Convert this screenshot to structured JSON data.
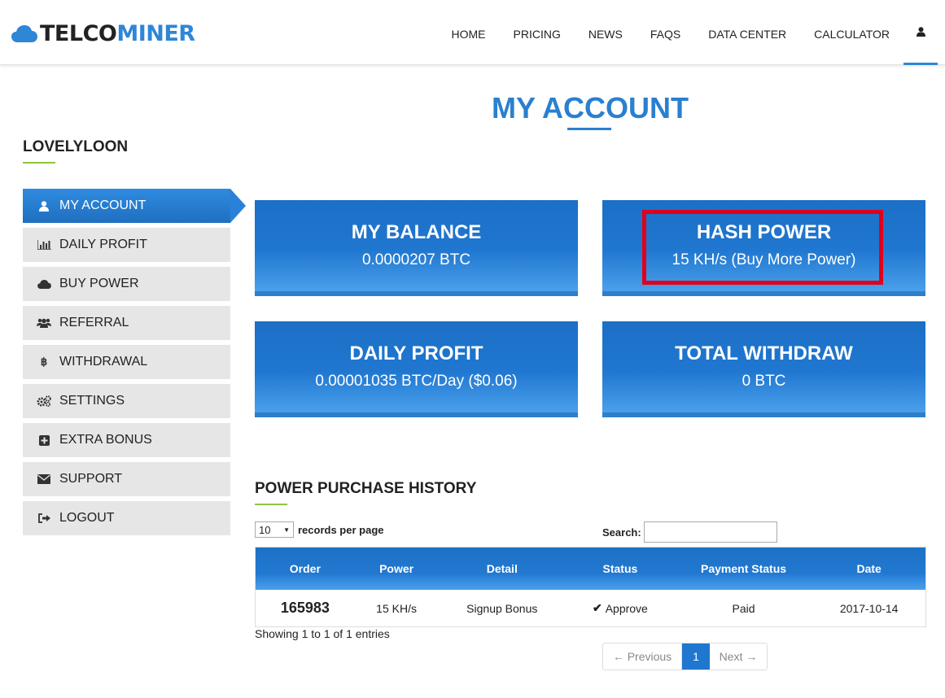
{
  "brand": {
    "part1": "TELCO",
    "part2": "MINER"
  },
  "nav": {
    "items": [
      {
        "label": "HOME"
      },
      {
        "label": "PRICING"
      },
      {
        "label": "NEWS"
      },
      {
        "label": "FAQS"
      },
      {
        "label": "DATA CENTER"
      },
      {
        "label": "CALCULATOR"
      }
    ],
    "user_icon": "user-icon"
  },
  "page": {
    "title": "MY ACCOUNT"
  },
  "sidebar": {
    "username": "LOVELYLOON",
    "items": [
      {
        "label": "MY ACCOUNT",
        "icon": "user-icon",
        "active": true
      },
      {
        "label": "DAILY PROFIT",
        "icon": "bar-chart-icon"
      },
      {
        "label": "BUY POWER",
        "icon": "cloud-icon"
      },
      {
        "label": "REFERRAL",
        "icon": "users-icon"
      },
      {
        "label": "WITHDRAWAL",
        "icon": "bitcoin-icon"
      },
      {
        "label": "SETTINGS",
        "icon": "gears-icon"
      },
      {
        "label": "EXTRA BONUS",
        "icon": "plus-square-icon"
      },
      {
        "label": "SUPPORT",
        "icon": "envelope-icon"
      },
      {
        "label": "LOGOUT",
        "icon": "sign-out-icon"
      }
    ]
  },
  "cards": {
    "balance": {
      "title": "MY BALANCE",
      "value": "0.0000207 BTC"
    },
    "hash": {
      "title": "HASH POWER",
      "value": "15 KH/s (Buy More Power)"
    },
    "profit": {
      "title": "DAILY PROFIT",
      "value": "0.00001035 BTC/Day ($0.06)"
    },
    "withdraw": {
      "title": "TOTAL WITHDRAW",
      "value": "0 BTC"
    }
  },
  "history": {
    "title": "POWER PURCHASE HISTORY",
    "per_page_value": "10",
    "per_page_label": "records per page",
    "search_label": "Search:",
    "search_value": "",
    "columns": [
      "Order",
      "Power",
      "Detail",
      "Status",
      "Payment Status",
      "Date"
    ],
    "rows": [
      {
        "order": "165983",
        "power": "15 KH/s",
        "detail": "Signup Bonus",
        "status": "Approve",
        "payment": "Paid",
        "date": "2017-10-14"
      }
    ],
    "showing": "Showing 1 to 1 of 1 entries",
    "pager": {
      "prev": "← Previous",
      "page": "1",
      "next": "Next →"
    }
  },
  "colors": {
    "accent": "#2a7fd0",
    "highlight": "#e0001b",
    "underline": "#8dc63f"
  }
}
